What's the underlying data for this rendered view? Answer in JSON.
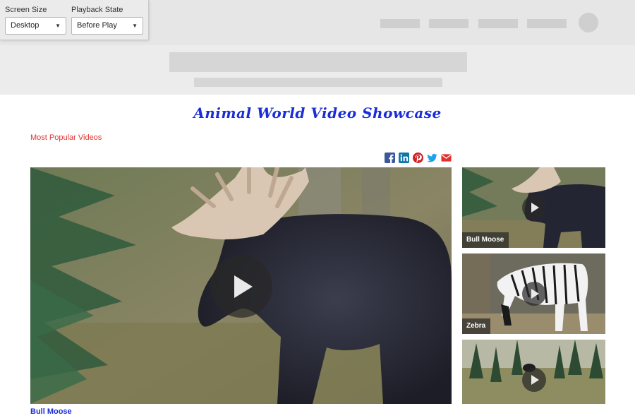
{
  "controls": {
    "screen_size": {
      "label": "Screen Size",
      "value": "Desktop"
    },
    "playback_state": {
      "label": "Playback State",
      "value": "Before Play"
    }
  },
  "page": {
    "title": "Animal World Video Showcase",
    "section_link": "Most Popular Videos",
    "title_color": "#1a2dd6",
    "link_color": "#e0312f"
  },
  "share_icons": [
    "facebook-icon",
    "linkedin-icon",
    "pinterest-icon",
    "twitter-icon",
    "email-icon"
  ],
  "main_video": {
    "caption": "Bull Moose"
  },
  "playlist": [
    {
      "label": "Bull Moose"
    },
    {
      "label": "Zebra"
    },
    {
      "label": ""
    }
  ]
}
